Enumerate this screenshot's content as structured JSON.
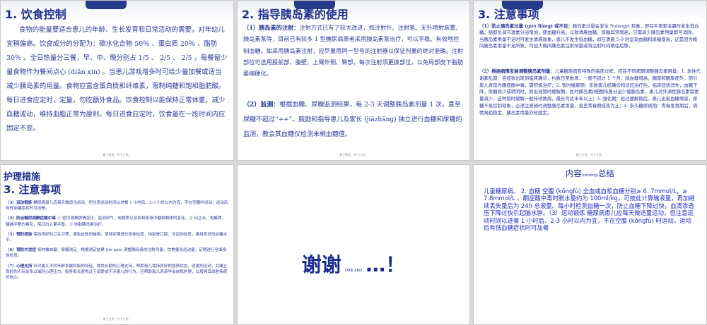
{
  "slides": [
    {
      "title": "1. 饮食控制",
      "body": "食物的能量要适合患儿的年龄、生长发育和日常活动的需要，对年幼儿宜稍偏高。饮食成分的分配为：碳水化合物 50％ 、蛋白质 20％ 、脂肪 30％ 。全日热量分三餐，早、中、晚分别占 1/5 、 2/5 、 2/5 ，每餐留少量食物作为餐间点心 (diǎn xin) 。当患儿游戏增多时可给少量加餐或适当减少胰岛素的用量。食物应富含蛋白质和纤维素，限制纯糖和饱和脂肪酸。每日进食应定时，定量，勿吃额外食品。饮食控制以能保持正常体重，减少血糖波动，维持血脂正常为原则。每日进食应定时，饮食量在一段时间内应固定不变。",
      "footer": "第十四页，共十六页。"
    },
    {
      "title": "2. 指导胰岛素的使用",
      "para1_label": "（1）胰岛素的注射：",
      "para1": "注射方式已有了较大改进，如注射针、注射笔、无针喷射装置、胰岛素泵等，目前已有较多 1 型糖尿病患者采用胰岛素泵治疗，可以平稳、有效地控制血糖。如采用胰岛素注射，应尽量用同一型号的注射器以保证剂量的绝对准确。注射部位可选用股前部、腹壁、上臂外侧、臀部，每次注射须更换部位，以免局部皮下脂肪萎缩硬化。",
      "para2_label": "（2）监测：",
      "para2": "根据血糖、尿糖监测结果，每 2-3 天调整胰岛素剂量 1 次，直至尿糖不超过“++”。鼓励和指导患儿及家长 (jiāzhǎng) 独立进行血糖和尿糖的监测，教会其血糖仪检测末梢血糖值。",
      "footer": "第十四页，共十六页。"
    },
    {
      "title": "3. 注意事项",
      "para1_label": "（1）防止胰岛素过量 (guò liàng) 或不足：",
      "para1": "胰岛素过量会发生 Somogyi 现象，即在午夜至凌晨时发生低血糖，随即反调节激素分泌增加，使血糖升高，以致清晨血糖、尿糖异常增高，只需减少胰岛素用量即可消除。当胰岛素用量不足时可发生清晨现象，患儿不发生低血糖，却在清晨 5-9 时呈现血糖和尿糖增高，这是因为晚间胰岛素用量不足所致，可加大晚间胰岛素注射剂量或将注射时间稍往后移。",
      "para2_label": "（2）根据病情发展调整胰岛素剂量：",
      "para2": "儿童糖尿病有特殊的临床过程，应在不同病期调整胰岛素用量：1. 急性代谢紊乱期：自症状出现到临床确诊，约数日至数周，一般不超过 1 个月，除血糖增高、糖尿和酮尿症外，部分患儿表现为酮症酸中毒，需积极治疗；2. 暂时缓解期：多数患儿经确诊和适应治疗后，临床症状消失，血糖下降，尿糖减少或转阴时，即出现暂时缓解期，此时胰岛素β细胞恢复分泌少量胰岛素，患儿对外源性胰岛素需要量减少，这种暂时缓解一般持续数周，最长可达半年以上；3. 强化期：经过缓解期后，患儿出现血糖增高，尿糖不易控制现象，必须注意随时调整胰岛素用量，直至青春期结束为止；4. 永久糖尿病期：青春发育期后，病情渐趋稳定，胰岛素用量亦较固定。",
      "footer": "第十六页，共十六页。"
    },
    {
      "heading": "护理措施",
      "title": "3. 注意事项",
      "items": [
        {
          "label": "（3）运动锻炼",
          "text": "糖尿病患儿应每天做适当运动，但注意运动时间以进餐 1 小时后、2-3 小时以内为宜，不在空腹时运动，运动后有低血糖症状时可加餐。"
        },
        {
          "label": "（4）防治糖尿病酮症酸中毒",
          "text": "① 密切观察病情变化，监测血气、电解质以及血和尿液中糖和酮体的变化。② 纠正水、电解质、酸碱平衡的紊乱，保证出入量平衡。③ 协助胰岛素治疗。"
        },
        {
          "label": "（5）预防感染",
          "text": "保持良好的卫生习惯，避免皮肤的破损，坚持定期进行身体检查，特别是口腔、牙齿的检查，维持良好的血糖水平。"
        },
        {
          "label": "（6）预防并发症",
          "text": "按时做血糖、尿糖测定，根据测定结果 (jié guǒ) 调整胰岛素的注射剂量，饮食量及运动量，定期进行全面身体检查。"
        },
        {
          "label": "（7）心理支持",
          "text": "针对患儿不同年龄发展阶段的特征，提供长期的心理支持，帮助患儿保持良好的营养状态、适度的运动，并建立良好的人际关系以减轻心理压力。指导家长避免过于溺爱或干涉患儿的行为，应帮助患儿逐渐学会自我护理，以增强其战胜疾病的信心。"
        }
      ],
      "footer": "第十五页，共十六页。"
    },
    {
      "thanks": "谢谢",
      "pinyin": "(xiè xie)",
      "ellipsis": "…",
      "bang": "！"
    },
    {
      "title": "内容",
      "title_pinyin": "(nèiróng)",
      "title_rest": "总结",
      "body": "儿童糖尿病。 2. 血糖 空腹 (kōngfù) 全血或血浆血糖分别≥ 6. 7mmol/L，≥ 7.8mmol/L 。酮症酸中毒时脱水量约为 100ml/kg，可按此计算输液量，再加继续丢失量后为 24h 总液量。每小时检测血糖一次，防止血糖下降过快，血清渗透压下降过快引起脑水肿。（3）运动锻炼 糖尿病患儿应每天做适量运动，但注意运动时间以进餐 1 小时后、2-3 小时以内为宜，不在空腹 (kōngfù) 时运动，运动后有低血糖症状时可加餐"
    }
  ],
  "colors": {
    "accent": "#1f2f8c",
    "text": "#2b3a9a",
    "band": "#263a8a"
  }
}
